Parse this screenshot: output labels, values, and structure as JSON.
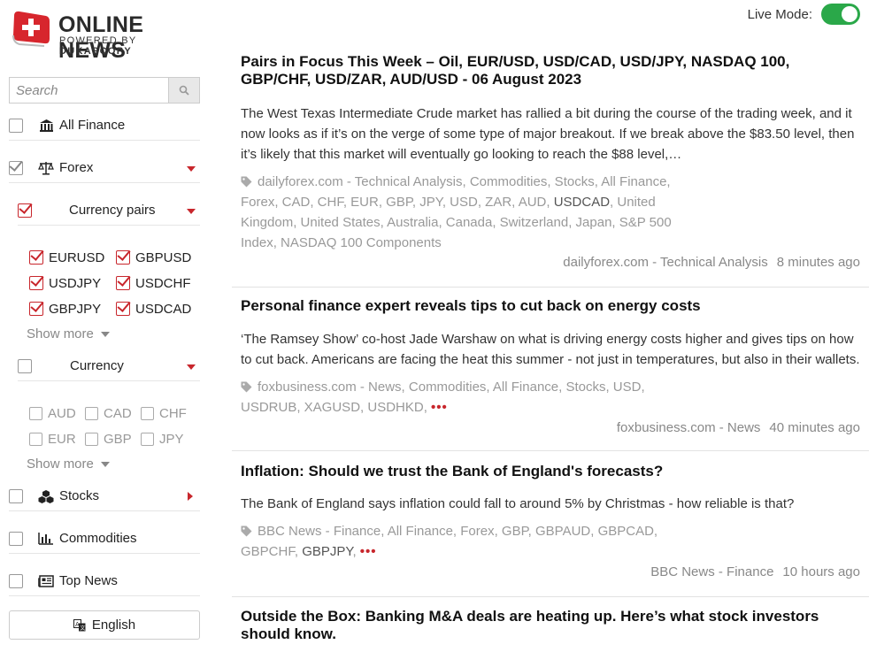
{
  "brand": {
    "title": "ONLINE NEWS",
    "powered_prefix": "POWERED BY ",
    "powered_brand": "DUKASCOPY"
  },
  "search": {
    "placeholder": "Search"
  },
  "sidebar": {
    "all_finance": "All Finance",
    "forex": "Forex",
    "currency_pairs": "Currency pairs",
    "pairs": [
      "EURUSD",
      "GBPUSD",
      "USDJPY",
      "USDCHF",
      "GBPJPY",
      "USDCAD"
    ],
    "show_more": "Show more",
    "currency": "Currency",
    "currencies": [
      "AUD",
      "CAD",
      "CHF",
      "EUR",
      "GBP",
      "JPY"
    ],
    "stocks": "Stocks",
    "commodities": "Commodities",
    "top_news": "Top News",
    "language": "English"
  },
  "live_mode": {
    "label": "Live Mode:",
    "on": true
  },
  "articles": [
    {
      "title": "Pairs in Focus This Week – Oil, EUR/USD, USD/CAD, USD/JPY, NASDAQ 100, GBP/CHF, USD/ZAR, AUD/USD - 06 August 2023",
      "body": "The West Texas Intermediate Crude market has rallied a bit during the course of the trading week, and it now looks as if it’s on the verge of some type of major breakout. If we break above the $83.50 level, then it’s likely that this market will eventually go looking to reach the $88 level,…",
      "tags_a": "dailyforex.com - Technical Analysis, Commodities, Stocks, All Finance, Forex, CAD, CHF, EUR, GBP, JPY, USD, ZAR, AUD, ",
      "tags_dark": "USDCAD",
      "tags_b": ", United Kingdom, United States, Australia, Canada, Switzerland, Japan, S&P 500 Index, NASDAQ 100 Components",
      "source": "dailyforex.com - Technical Analysis",
      "time": "8 minutes ago"
    },
    {
      "title": "Personal finance expert reveals tips to cut back on energy costs",
      "body": "‘The Ramsey Show’ co-host Jade Warshaw on what is driving energy costs higher and gives tips on how to cut back. Americans are facing the heat this summer - not just in temperatures, but also in their wallets.",
      "tags_a": "foxbusiness.com - News, Commodities, All Finance, Stocks, USD, USDRUB, XAGUSD, USDHKD, ",
      "more": "•••",
      "source": "foxbusiness.com - News",
      "time": "40 minutes ago"
    },
    {
      "title": "Inflation: Should we trust the Bank of England's forecasts?",
      "body": "The Bank of England says inflation could fall to around 5% by Christmas - how reliable is that?",
      "tags_a": "BBC News - Finance, All Finance, Forex, GBP, GBPAUD, GBPCAD, GBPCHF, ",
      "tags_dark": "GBPJPY",
      "tags_b": ", ",
      "more": "•••",
      "source": "BBC News - Finance",
      "time": "10 hours ago"
    },
    {
      "title": "Outside the Box: Banking M&A deals are heating up. Here’s what stock investors should know."
    }
  ],
  "colors": {
    "accent_red": "#c8262c",
    "toggle_green": "#2aa849"
  },
  "icons": {
    "search": "search-icon",
    "bank": "bank-icon",
    "scale": "scale-icon",
    "stocks": "cubes-icon",
    "commodities": "bar-chart-icon",
    "news": "newspaper-icon",
    "language": "translate-icon",
    "tag": "tag-icon"
  }
}
